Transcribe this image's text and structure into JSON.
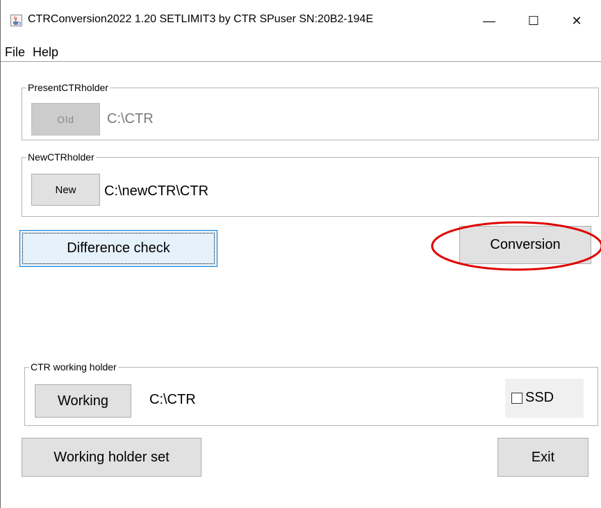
{
  "window": {
    "title": "CTRConversion2022 1.20 SETLIMIT3 by CTR SPuser   SN:20B2-194E",
    "minimize": "—",
    "maximize": "☐",
    "close": "✕"
  },
  "menu": [
    "File",
    "Help"
  ],
  "present_holder": {
    "label": "PresentCTRholder",
    "button": "Old",
    "path": "C:\\CTR",
    "button_enabled": false
  },
  "new_holder": {
    "label": "NewCTRholder",
    "button": "New",
    "path": "C:\\newCTR\\CTR"
  },
  "actions": {
    "difference_check": "Difference check",
    "conversion": "Conversion"
  },
  "working_holder": {
    "label": "CTR working holder",
    "button": "Working",
    "path": "C:\\CTR",
    "ssd_label": "SSD",
    "ssd_checked": false
  },
  "footer": {
    "working_holder_set": "Working holder set",
    "exit": "Exit"
  },
  "annotation": {
    "highlight_color": "#e00000"
  },
  "icons": {
    "app": "java-cup-icon",
    "checkbox": "checkbox-icon"
  }
}
